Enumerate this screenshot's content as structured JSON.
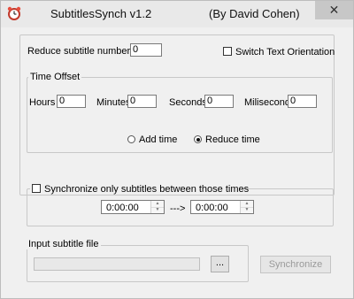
{
  "window": {
    "title": "SubtitlesSynch v1.2",
    "author": "(By David Cohen)",
    "close_icon": "close-icon",
    "app_icon": "alarm-clock-icon"
  },
  "reduce": {
    "label": "Reduce subtitle number by:",
    "value": "0"
  },
  "switch_orientation": {
    "label": "Switch Text Orientation",
    "checked": false
  },
  "time_offset": {
    "legend": "Time Offset",
    "hours_label": "Hours",
    "hours_value": "0",
    "minutes_label": "Minutes",
    "minutes_value": "0",
    "seconds_label": "Seconds",
    "seconds_value": "0",
    "miliseconds_label": "Miliseconds",
    "miliseconds_value": "0",
    "add_label": "Add time",
    "reduce_label": "Reduce time",
    "selected": "Reduce time"
  },
  "sync_range": {
    "checkbox_label": "Synchronize only subtitles between those times",
    "checked": false,
    "from_value": "0:00:00",
    "arrow": "--->",
    "to_value": "0:00:00"
  },
  "input_file": {
    "legend": "Input subtitle file",
    "path_value": "",
    "browse_label": "..."
  },
  "synchronize_button": "Synchronize"
}
